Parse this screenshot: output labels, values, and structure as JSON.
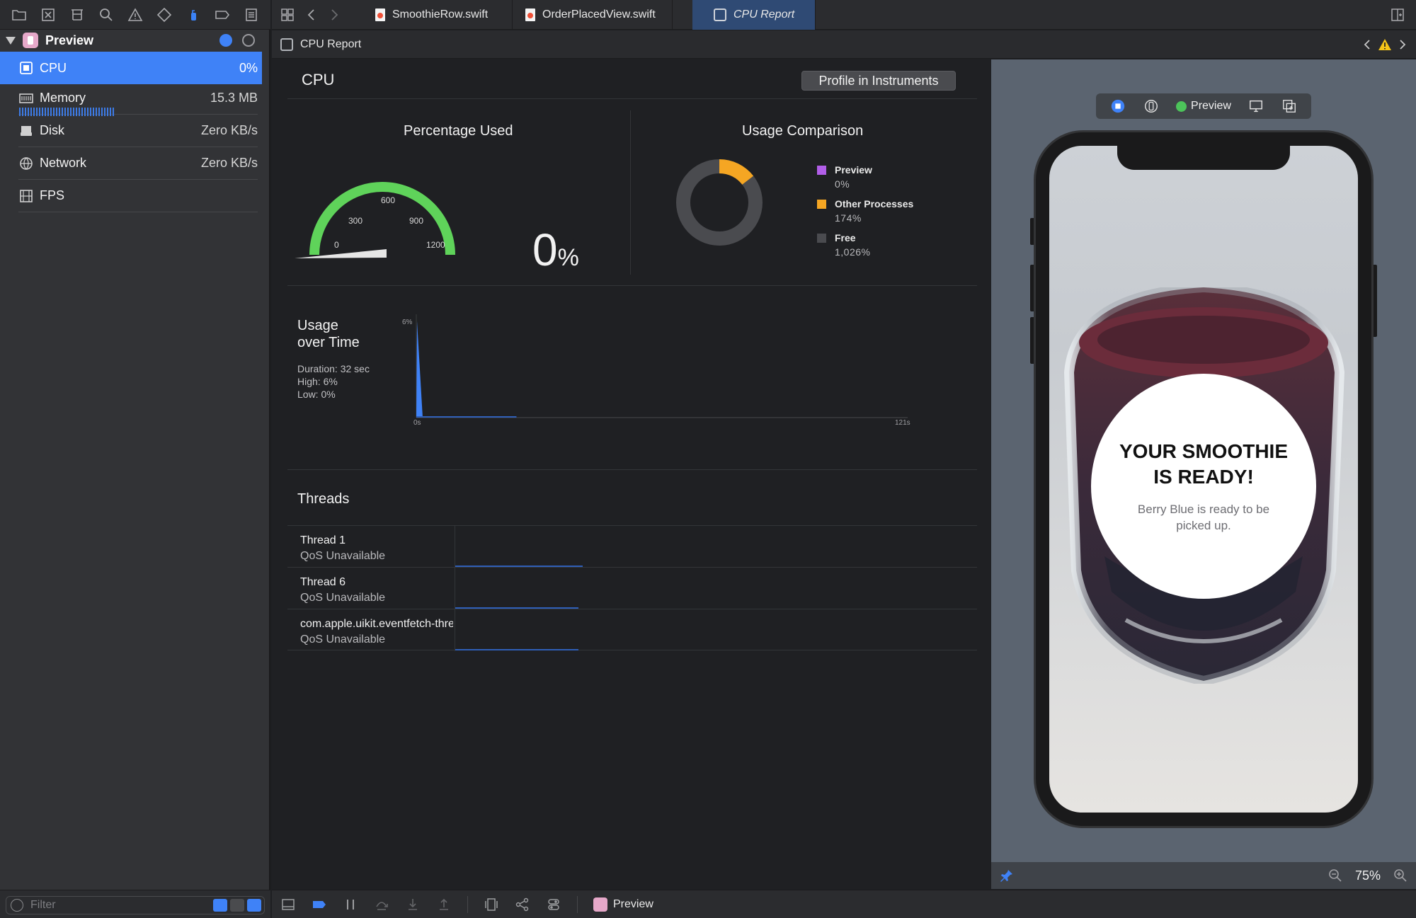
{
  "tabs": [
    {
      "label": "SmoothieRow.swift"
    },
    {
      "label": "OrderPlacedView.swift"
    },
    {
      "label": "CPU Report"
    }
  ],
  "jumpbar": {
    "title": "CPU Report"
  },
  "navigator": {
    "process": "Preview",
    "gauges": [
      {
        "name": "CPU",
        "value": "0%"
      },
      {
        "name": "Memory",
        "value": "15.3 MB"
      },
      {
        "name": "Disk",
        "value": "Zero KB/s"
      },
      {
        "name": "Network",
        "value": "Zero KB/s"
      },
      {
        "name": "FPS",
        "value": ""
      }
    ],
    "filter_placeholder": "Filter"
  },
  "report": {
    "title": "CPU",
    "profile_button": "Profile in Instruments",
    "percentage_used": {
      "title": "Percentage Used",
      "value": "0",
      "unit": "%",
      "gauge_ticks": [
        "0",
        "300",
        "600",
        "900",
        "1200"
      ],
      "gauge_value": 0,
      "gauge_max": 1200
    },
    "usage_comparison": {
      "title": "Usage Comparison",
      "legend": [
        {
          "name": "Preview",
          "value": "0%",
          "color": "#b15ee8"
        },
        {
          "name": "Other Processes",
          "value": "174%",
          "color": "#f5a623"
        },
        {
          "name": "Free",
          "value": "1,026%",
          "color": "#4a4b4f"
        }
      ]
    },
    "usage_over_time": {
      "title_line1": "Usage",
      "title_line2": "over Time",
      "duration": "Duration: 32 sec",
      "high": "High: 6%",
      "low": "Low: 0%",
      "y_max_label": "6%",
      "x_start_label": "0s",
      "x_end_label": "121s"
    },
    "threads": {
      "title": "Threads",
      "items": [
        {
          "name": "Thread 1",
          "qos": "QoS Unavailable"
        },
        {
          "name": "Thread 6",
          "qos": "QoS Unavailable"
        },
        {
          "name": "com.apple.uikit.eventfetch-thread",
          "qos": "QoS Unavailable"
        }
      ]
    }
  },
  "chart_data": [
    {
      "type": "pie",
      "title": "Usage Comparison",
      "categories": [
        "Preview",
        "Other Processes",
        "Free"
      ],
      "values": [
        0,
        174,
        1026
      ],
      "unit": "%"
    },
    {
      "type": "area",
      "title": "Usage over Time",
      "x": [
        0,
        0.5,
        1,
        2,
        121
      ],
      "y": [
        0,
        6,
        0,
        0,
        0
      ],
      "xlabel": "",
      "ylabel": "",
      "xlim": [
        0,
        121
      ],
      "ylim": [
        0,
        6
      ]
    }
  ],
  "preview": {
    "toolbar_label": "Preview",
    "headline": "YOUR SMOOTHIE IS READY!",
    "subtext": "Berry Blue is ready to be picked up.",
    "zoom": "75%"
  },
  "debugbar": {
    "target": "Preview"
  },
  "colors": {
    "accent": "#3f82f7",
    "gauge_green": "#5fd35a",
    "other_orange": "#f5a623",
    "preview_purple": "#b15ee8"
  }
}
